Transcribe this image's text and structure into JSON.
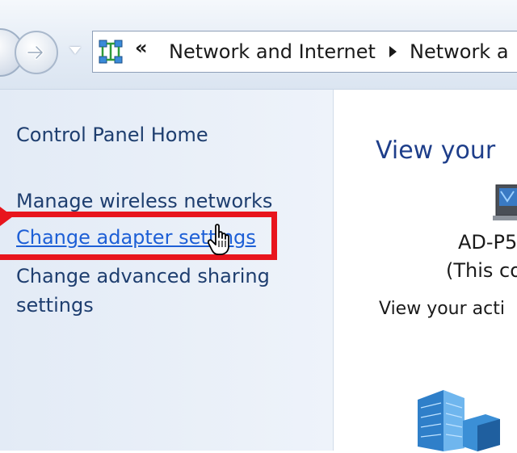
{
  "address_bar": {
    "overflow_marker": "«",
    "breadcrumb_1": "Network and Internet",
    "breadcrumb_2": "Network a"
  },
  "left_pane": {
    "home": "Control Panel Home",
    "wireless": "Manage wireless networks",
    "adapter": "Change adapter settings",
    "advanced": "Change advanced sharing settings"
  },
  "main": {
    "title": "View your",
    "device_name": "AD-P5",
    "device_sub": "(This co",
    "active_label": "View your acti"
  },
  "colors": {
    "highlight": "#e8151d",
    "link": "#1d5fd6",
    "task_text": "#1e3e6f",
    "title": "#1e3e8a"
  },
  "icons": [
    "back-arrow-icon",
    "forward-arrow-icon",
    "network-icon",
    "breadcrumb-arrow-icon",
    "hand-cursor-icon",
    "computer-icon",
    "network-building-icon"
  ]
}
